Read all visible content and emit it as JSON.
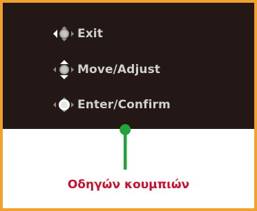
{
  "osd": {
    "items": [
      {
        "label": "Exit",
        "icon": "joystick-left-icon"
      },
      {
        "label": "Move/Adjust",
        "icon": "joystick-up-down-icon"
      },
      {
        "label": "Enter/Confirm",
        "icon": "joystick-press-icon"
      }
    ]
  },
  "caption": "Οδηγών κουμπιών",
  "colors": {
    "frame": "#f0a22e",
    "osd_background": "#231815",
    "label": "#d0d0d0",
    "pointer": "#22a33a",
    "caption": "#c8102e"
  }
}
